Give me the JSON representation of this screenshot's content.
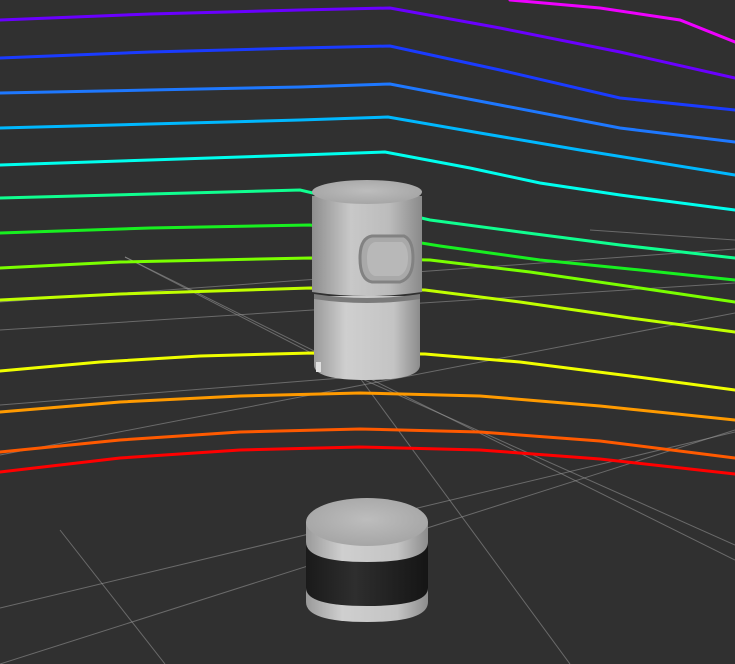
{
  "viewport": {
    "background": "#303030",
    "grid_color": "#a0a0a0",
    "scan_colors": [
      "#ee00ff",
      "#6a00ff",
      "#1a3bff",
      "#1e78ff",
      "#00b8ff",
      "#00ffee",
      "#10ff90",
      "#18f020",
      "#9aff00",
      "#f0ff00",
      "#ff8800",
      "#ff5500",
      "#ff0000"
    ]
  },
  "objects": [
    {
      "id": "lidar-sensor-model",
      "label": ""
    },
    {
      "id": "robot-base-model",
      "label": ""
    }
  ]
}
